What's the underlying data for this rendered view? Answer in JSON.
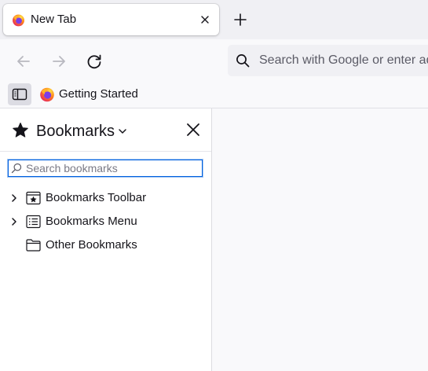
{
  "tabs": [
    {
      "title": "New Tab",
      "favicon": "firefox-logo-icon",
      "active": true
    }
  ],
  "toolbar": {
    "back_icon": "back-arrow-icon",
    "forward_icon": "forward-arrow-icon",
    "reload_icon": "reload-icon",
    "new_tab_icon": "plus-icon"
  },
  "urlbar": {
    "placeholder": "Search with Google or enter address"
  },
  "bookmarks_toolbar": {
    "items": [
      {
        "label": "Getting Started",
        "icon": "firefox-logo-icon"
      }
    ]
  },
  "sidebar": {
    "title": "Bookmarks",
    "search_placeholder": "Search bookmarks",
    "tree": [
      {
        "label": "Bookmarks Toolbar",
        "icon": "bookmarks-toolbar-folder-icon",
        "expandable": true
      },
      {
        "label": "Bookmarks Menu",
        "icon": "bookmarks-menu-folder-icon",
        "expandable": true
      },
      {
        "label": "Other Bookmarks",
        "icon": "folder-icon",
        "expandable": false
      }
    ]
  },
  "colors": {
    "accent": "#0060df",
    "chrome_bg": "#f9f9fb",
    "tabstrip_bg": "#f0f0f4",
    "text": "#15141a"
  }
}
